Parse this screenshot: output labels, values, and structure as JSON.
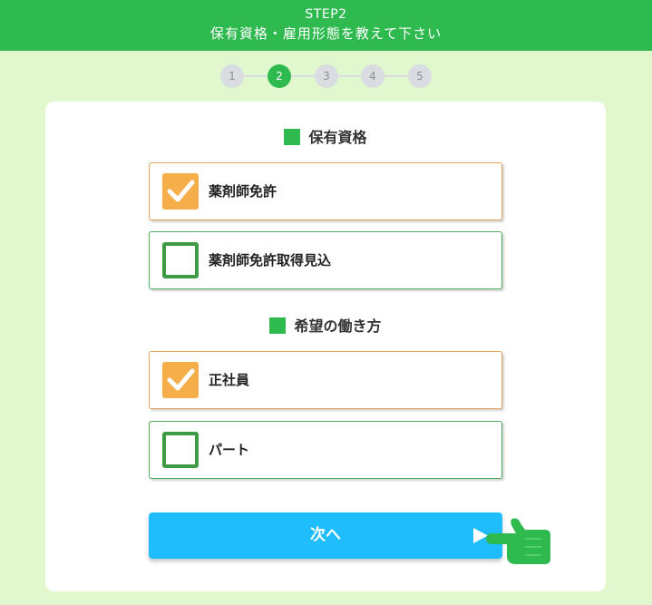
{
  "header": {
    "step": "STEP2",
    "title": "保有資格・雇用形態を教えて下さい"
  },
  "stepper": {
    "steps": [
      "1",
      "2",
      "3",
      "4",
      "5"
    ],
    "active": "2"
  },
  "sections": [
    {
      "title": "保有資格",
      "options": [
        {
          "label": "薬剤師免許",
          "checked": true
        },
        {
          "label": "薬剤師免許取得見込",
          "checked": false
        }
      ]
    },
    {
      "title": "希望の働き方",
      "options": [
        {
          "label": "正社員",
          "checked": true
        },
        {
          "label": "パート",
          "checked": false
        }
      ]
    }
  ],
  "next_button": {
    "label": "次へ",
    "icon": "play-arrow-icon"
  },
  "icons": {
    "check": "checkmark-icon",
    "pointer": "pointing-hand-icon"
  },
  "colors": {
    "header_bg": "#2fba4f",
    "page_bg": "#e1f8cf",
    "checked_box": "#f5ae4a",
    "checked_border": "#e5a35d",
    "unchecked_border": "#3f9a46",
    "button_bg": "#20bdfc",
    "stepper_inactive": "#d9dde1",
    "stepper_active": "#2fba4f"
  }
}
